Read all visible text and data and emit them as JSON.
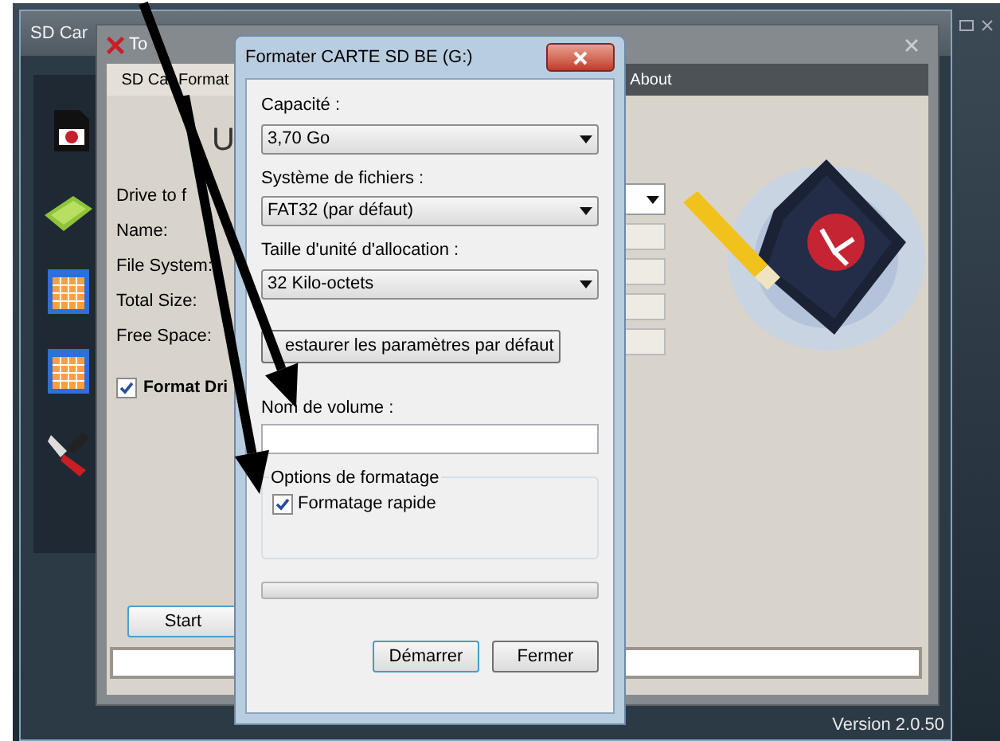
{
  "main_window": {
    "title": "SD Car",
    "version": "Version 2.0.50"
  },
  "tools_window": {
    "title": "To",
    "tabs": [
      {
        "label": "SD Ca",
        "label_after_arrow": "Format",
        "selected": true
      },
      {
        "label": "About",
        "selected": false
      }
    ],
    "heading": "U",
    "fields": [
      {
        "label": "Drive to f",
        "kind": "select"
      },
      {
        "label": "Name:",
        "kind": "input"
      },
      {
        "label": "File System:",
        "kind": "input"
      },
      {
        "label": "Total Size:",
        "kind": "input"
      },
      {
        "label": "Free Space:",
        "kind": "input"
      }
    ],
    "format_drive": {
      "label": "Format Dri",
      "checked": true
    },
    "start_button": "Start"
  },
  "dialog": {
    "title": "Formater CARTE SD BE (G:)",
    "controls": [
      {
        "kind": "select",
        "label": "Capacité :",
        "value": "3,70 Go"
      },
      {
        "kind": "select",
        "label": "Système de fichiers :",
        "value": "FAT32 (par défaut)"
      },
      {
        "kind": "select",
        "label": "Taille d'unité d'allocation :",
        "value": "32 Kilo-octets"
      },
      {
        "kind": "button",
        "value": "estaurer les paramètres par défaut"
      },
      {
        "kind": "input",
        "label": "Nom de volume :"
      }
    ],
    "options": {
      "title": "Options de formatage",
      "quick_format": {
        "label": "Formatage rapide",
        "checked": true
      }
    },
    "progress": {
      "level": 0
    },
    "buttons": [
      {
        "label": "Démarrer",
        "default": true
      },
      {
        "label": "Fermer",
        "default": false
      }
    ]
  }
}
